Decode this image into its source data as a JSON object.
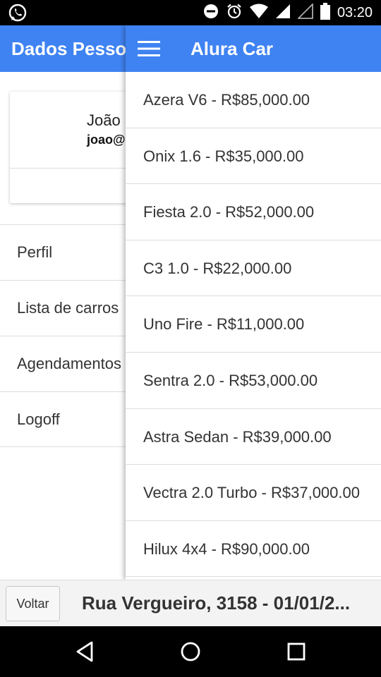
{
  "status_bar": {
    "time": "03:20",
    "icons": [
      "whatsapp-icon",
      "do-not-disturb-icon",
      "alarm-icon",
      "wifi-icon",
      "signal-icon",
      "no-signal-icon",
      "battery-icon"
    ]
  },
  "left_panel": {
    "toolbar_title": "Dados Pesso",
    "user": {
      "name": "João",
      "email": "joao@"
    },
    "menu": [
      "Perfil",
      "Lista de carros",
      "Agendamentos",
      "Logoff"
    ]
  },
  "right_panel": {
    "title": "Alura Car",
    "cars": [
      "Azera V6 - R$85,000.00",
      "Onix 1.6 - R$35,000.00",
      "Fiesta 2.0 - R$52,000.00",
      "C3 1.0 - R$22,000.00",
      "Uno Fire - R$11,000.00",
      "Sentra 2.0 - R$53,000.00",
      "Astra Sedan - R$39,000.00",
      "Vectra 2.0 Turbo - R$37,000.00",
      "Hilux 4x4 - R$90,000.00"
    ]
  },
  "bottom_bar": {
    "back_label": "Voltar",
    "address": "Rua Vergueiro, 3158 - 01/01/2..."
  },
  "colors": {
    "accent": "#3f83f2",
    "status_bar": "#000000"
  }
}
